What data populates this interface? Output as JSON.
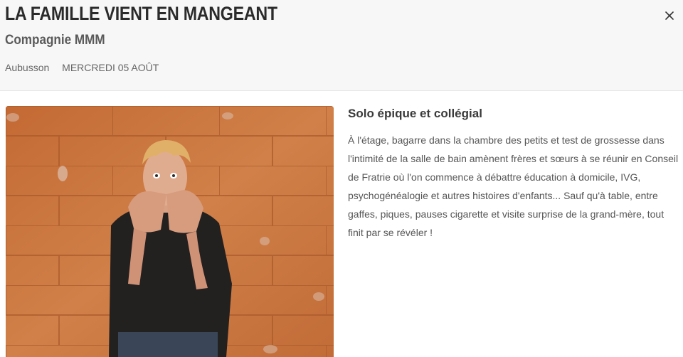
{
  "header": {
    "title": "LA FAMILLE VIENT EN MANGEANT",
    "company": "Compagnie MMM",
    "location": "Aubusson",
    "date": "MERCREDI 05 AOÛT",
    "close_icon": "close-icon"
  },
  "image": {
    "icon": "performer-photo"
  },
  "details": {
    "heading": "Solo épique et collégial",
    "description": "À l'étage, bagarre dans la chambre des petits et test de grossesse dans l'intimité de la salle de bain amènent frères et sœurs à se réunir en Conseil de Fratrie où l'on commence à débattre éducation à domicile, IVG, psychogénéalogie et autres histoires d'enfants... Sauf qu'à table, entre gaffes, piques, pauses cigarette et visite surprise de la grand-mère, tout finit par se révéler !"
  },
  "colors": {
    "header_bg": "#f7f7f7",
    "brick": "#c9733d",
    "text": "#333333"
  }
}
